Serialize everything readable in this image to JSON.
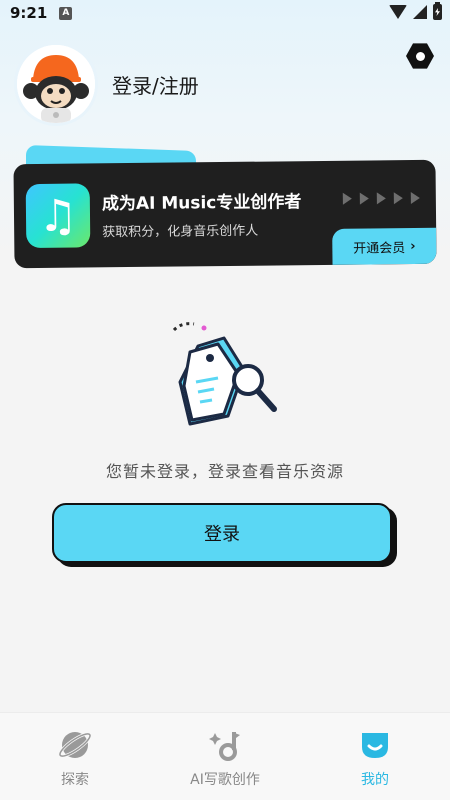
{
  "status_bar": {
    "time": "9:21",
    "notification_glyph": "A"
  },
  "profile": {
    "login_label": "登录/注册",
    "avatar_icon": "monkey-avatar-icon",
    "settings_icon": "gear-icon"
  },
  "vip_card": {
    "title": "成为AI Music专业创作者",
    "subtitle": "获取积分，化身音乐创作人",
    "button_label": "开通会员",
    "icon": "music-note-icon",
    "accent": "#5ad7f4",
    "background": "#1f1f1f"
  },
  "empty_state": {
    "message": "您暂未登录，登录查看音乐资源",
    "icon": "search-tag-icon"
  },
  "login_button": {
    "label": "登录"
  },
  "bottom_nav": {
    "items": [
      {
        "label": "探索",
        "icon": "planet-icon",
        "active": false
      },
      {
        "label": "AI写歌创作",
        "icon": "music-sparkle-icon",
        "active": false
      },
      {
        "label": "我的",
        "icon": "profile-face-icon",
        "active": true
      }
    ],
    "active_color": "#2ab8e2"
  }
}
